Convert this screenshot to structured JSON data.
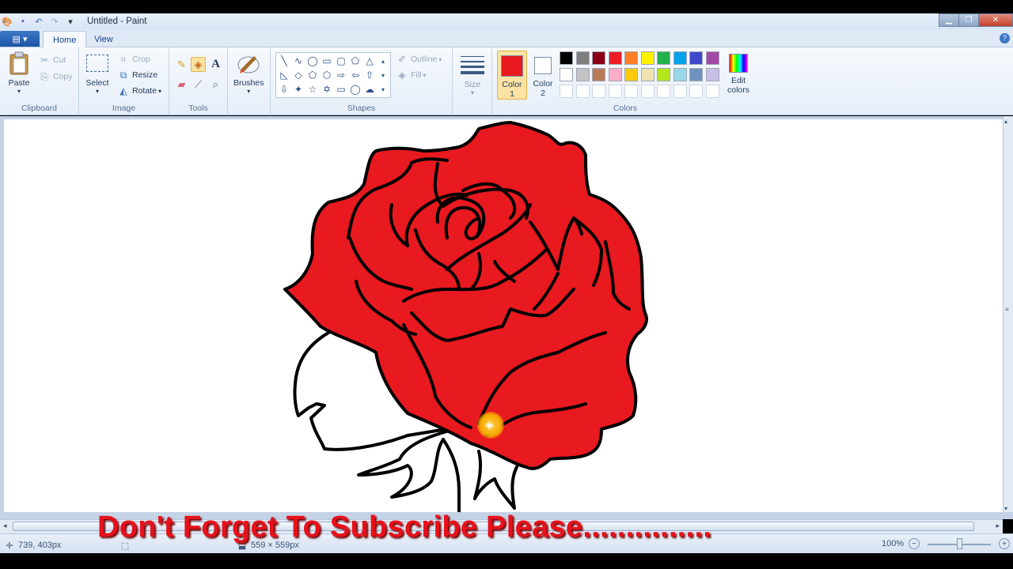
{
  "window": {
    "title": "Untitled - Paint",
    "controls": [
      "minimize",
      "maximize",
      "close"
    ]
  },
  "tabs": {
    "file_label": "▤ ▾",
    "items": [
      {
        "label": "Home",
        "active": true
      },
      {
        "label": "View",
        "active": false
      }
    ]
  },
  "ribbon": {
    "clipboard": {
      "label": "Clipboard",
      "paste": "Paste",
      "cut": "Cut",
      "copy": "Copy"
    },
    "image": {
      "label": "Image",
      "select": "Select",
      "crop": "Crop",
      "resize": "Resize",
      "rotate": "Rotate"
    },
    "tools": {
      "label": "Tools",
      "selected_tool": "fill"
    },
    "brushes": {
      "label": "Brushes"
    },
    "shapes": {
      "label": "Shapes",
      "outline": "Outline",
      "fill": "Fill"
    },
    "size": {
      "label": "Size"
    },
    "colors": {
      "label": "Colors",
      "color1_label": "Color",
      "color1_num": "1",
      "color1_value": "#e8191f",
      "color2_label": "Color",
      "color2_num": "2",
      "color2_value": "#ffffff",
      "edit_label": "Edit",
      "edit_label2": "colors",
      "palette_row1": [
        "#000000",
        "#7f7f7f",
        "#880015",
        "#ed1c24",
        "#ff7f27",
        "#fff200",
        "#22b14c",
        "#00a2e8",
        "#3f48cc",
        "#a349a4"
      ],
      "palette_row2": [
        "#ffffff",
        "#c3c3c3",
        "#b97a57",
        "#ffaec9",
        "#ffc90e",
        "#efe4b0",
        "#b5e61d",
        "#99d9ea",
        "#7092be",
        "#c8bfe7"
      ],
      "palette_row3": [
        "#ffffff",
        "#ffffff",
        "#ffffff",
        "#ffffff",
        "#ffffff",
        "#ffffff",
        "#ffffff",
        "#ffffff",
        "#ffffff",
        "#ffffff"
      ]
    }
  },
  "drawing": {
    "rose_fill": "#e8191f",
    "outline": "#000000"
  },
  "status": {
    "cursor_pos": "739, 403px",
    "canvas_size": "559 × 559px",
    "zoom": "100%"
  },
  "overlay": {
    "caption": "Don't Forget To Subscribe Please..............."
  }
}
